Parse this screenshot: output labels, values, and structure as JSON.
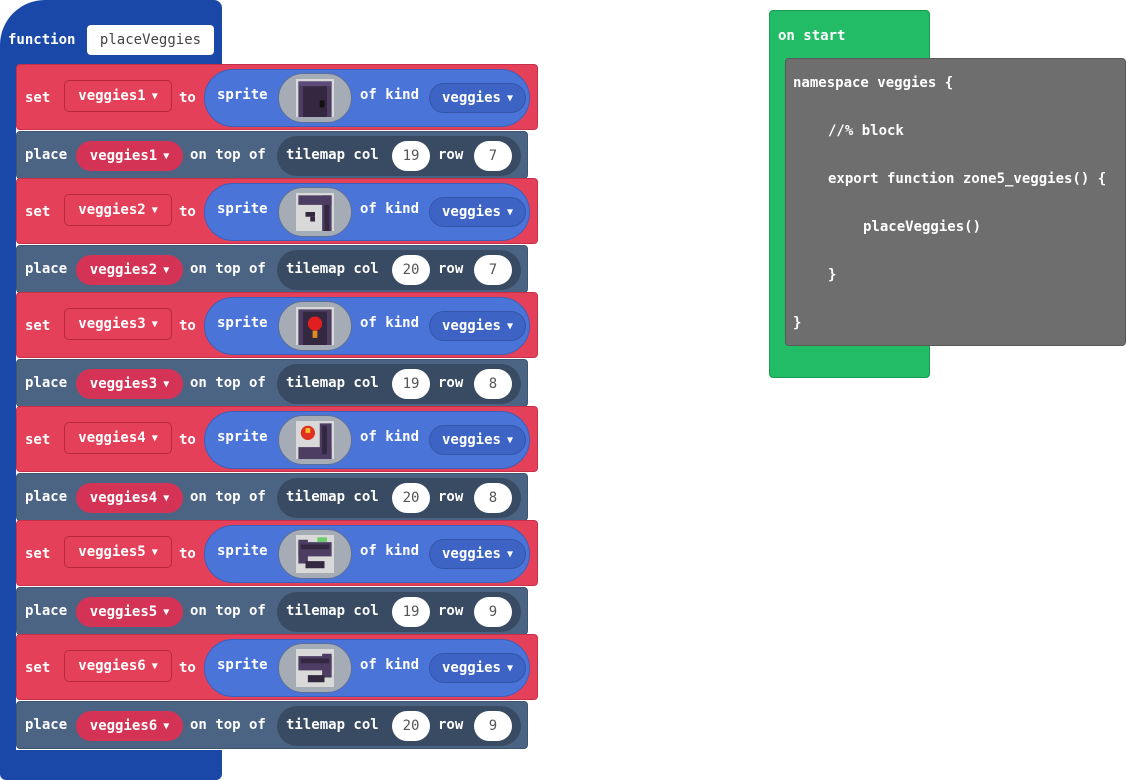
{
  "function_block": {
    "keyword": "function",
    "name": "placeVeggies"
  },
  "labels": {
    "set": "set",
    "to": "to",
    "sprite": "sprite",
    "of_kind": "of kind",
    "place": "place",
    "on_top_of": "on top of",
    "tilemap_col": "tilemap col",
    "row": "row"
  },
  "rows": [
    {
      "variable": "veggies1",
      "kind": "veggies",
      "col": "19",
      "row": "7",
      "sprite_icon": "door-sprite-icon"
    },
    {
      "variable": "veggies2",
      "kind": "veggies",
      "col": "20",
      "row": "7",
      "sprite_icon": "corner-sprite-icon"
    },
    {
      "variable": "veggies3",
      "kind": "veggies",
      "col": "19",
      "row": "8",
      "sprite_icon": "red-lamp-sprite-icon"
    },
    {
      "variable": "veggies4",
      "kind": "veggies",
      "col": "20",
      "row": "8",
      "sprite_icon": "lamp-wall-sprite-icon"
    },
    {
      "variable": "veggies5",
      "kind": "veggies",
      "col": "19",
      "row": "9",
      "sprite_icon": "pipe-bottom-left-sprite-icon"
    },
    {
      "variable": "veggies6",
      "kind": "veggies",
      "col": "20",
      "row": "9",
      "sprite_icon": "pipe-bottom-right-sprite-icon"
    }
  ],
  "on_start": {
    "label": "on start",
    "code": [
      "namespace veggies {",
      "//% block",
      "export function zone5_veggies() {",
      "placeVeggies()",
      "}",
      "}"
    ]
  },
  "colors": {
    "function_block": "#1a48a8",
    "set_block": "#e5405a",
    "place_block": "#4c6484",
    "sprite_block": "#4a74d8",
    "on_start_block": "#22bb66",
    "code_block": "#6e6e6e"
  }
}
